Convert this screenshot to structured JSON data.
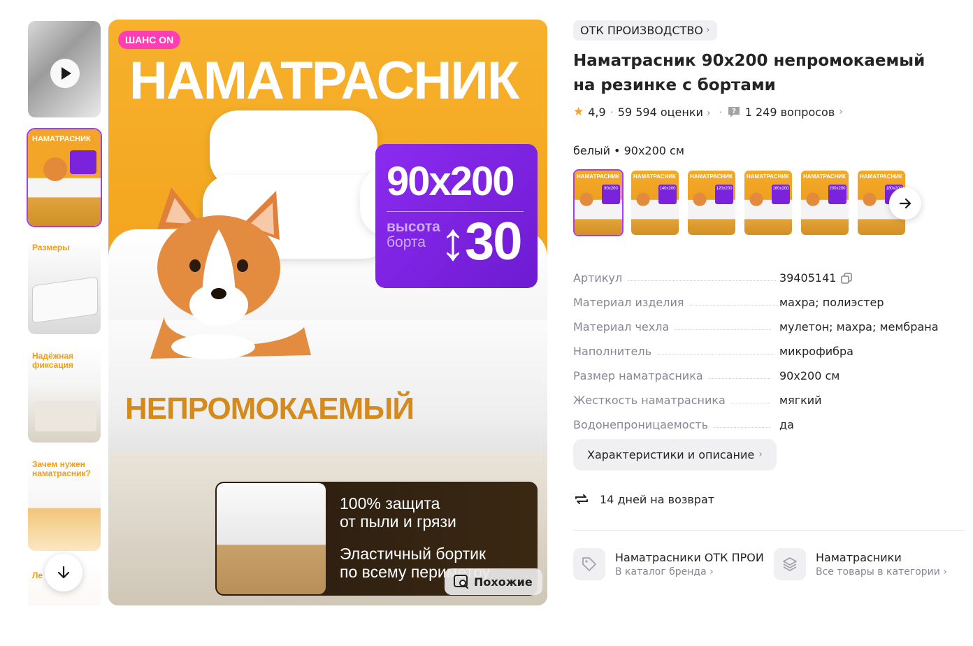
{
  "gallery": {
    "thumbnails": [
      {
        "kind": "video",
        "label": ""
      },
      {
        "kind": "image",
        "label": "НАМАТРАСНИК",
        "selected": true
      },
      {
        "kind": "image",
        "label": "Размеры"
      },
      {
        "kind": "image",
        "label": "Надёжная фиксация"
      },
      {
        "kind": "image",
        "label": "Зачем нужен наматрасник?"
      },
      {
        "kind": "image",
        "label": "Ле"
      }
    ],
    "main": {
      "badge": "ШАНС ON",
      "headline": "НАМАТРАСНИК",
      "size": "90х200",
      "height_label_1": "высота",
      "height_label_2": "борта",
      "height_value": "↕30",
      "waterproof": "НЕПРОМОКАЕМЫЙ",
      "feature_1": "100% защита\nот пыли и грязи",
      "feature_2": "Эластичный бортик\nпо всему периметру",
      "similar_button": "Похожие"
    }
  },
  "product": {
    "brand": "ОТК ПРОИЗВОДСТВО",
    "title": "Наматрасник 90х200 непромокаемый на резинке с бортами",
    "rating": "4,9",
    "reviews": "59 594 оценки",
    "questions": "1 249 вопросов",
    "color_size": "белый • 90х200 см",
    "variants": [
      {
        "title": "НАМАТРАСНИК",
        "size": "90х200",
        "selected": true
      },
      {
        "title": "НАМАТРАСНИК",
        "size": "140х200"
      },
      {
        "title": "НАМАТРАСНИК",
        "size": "120х200"
      },
      {
        "title": "НАМАТРАСНИК",
        "size": "160х200"
      },
      {
        "title": "НАМАТРАСНИК",
        "size": "200х200"
      },
      {
        "title": "НАМАТРАСНИК",
        "size": "180х200"
      }
    ],
    "specs": [
      {
        "key": "Артикул",
        "value": "39405141",
        "copy": true
      },
      {
        "key": "Материал изделия",
        "value": "махра; полиэстер"
      },
      {
        "key": "Материал чехла",
        "value": "мулетон; махра; мембрана"
      },
      {
        "key": "Наполнитель",
        "value": "микрофибра"
      },
      {
        "key": "Размер наматрасника",
        "value": "90х200 см"
      },
      {
        "key": "Жесткость наматрасника",
        "value": "мягкий"
      },
      {
        "key": "Водонепроницаемость",
        "value": "да"
      }
    ],
    "characteristics_button": "Характеристики и описание",
    "return_text": "14 дней на возврат",
    "links": [
      {
        "title": "Наматрасники ОТК ПРОИ",
        "subtitle": "В каталог бренда",
        "icon": "tag-icon"
      },
      {
        "title": "Наматрасники",
        "subtitle": "Все товары в категории",
        "icon": "layers-icon"
      }
    ]
  },
  "colors": {
    "accent": "#a73afd",
    "badge": "#ff3eb5",
    "star": "#ff9f1c",
    "muted": "#868695"
  }
}
